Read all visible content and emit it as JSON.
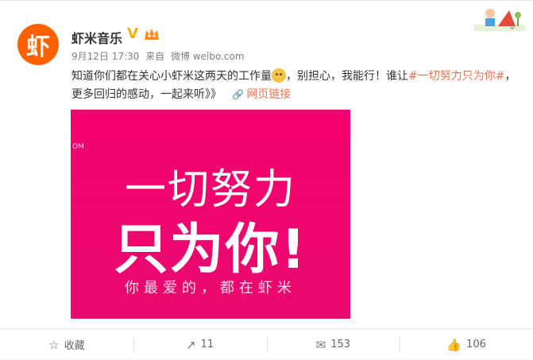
{
  "post": {
    "author": "虾米音乐",
    "avatar_glyph": "虾",
    "verified_icon": "V",
    "meta": {
      "date": "9月12日 17:30",
      "from": "来自",
      "source": "微博 weibo.com"
    },
    "text": {
      "part1": "知道你们都在关心小虾米这两天的工作量",
      "part2": "，别担心，我能行！谁让",
      "hashtag": "#一切努力只为你#",
      "part3": "，更多回归的感动，一起来听》》",
      "link_icon": "🔗",
      "link_text": "网页链接"
    },
    "image": {
      "corner": "OM",
      "line1": "一切努力",
      "line2": "只为你!",
      "line3": "你最爱的，都在虾米"
    },
    "actions": [
      {
        "icon": "☆",
        "label": "收藏"
      },
      {
        "icon": "↗",
        "label": "11"
      },
      {
        "icon": "✉",
        "label": "153"
      },
      {
        "icon": "👍",
        "label": "106"
      }
    ]
  },
  "colors": {
    "brand_orange": "#ff6000",
    "link": "#eb7350",
    "image_pink": "#f4006f"
  }
}
